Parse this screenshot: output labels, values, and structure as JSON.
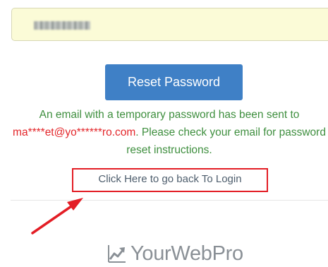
{
  "form": {
    "input_value": "",
    "reset_button_label": "Reset Password"
  },
  "message": {
    "prefix": "An email with a temporary password has been sent to ",
    "masked_email": "ma****et@yo******ro.com",
    "suffix": ". Please check your email for password reset instructions."
  },
  "login_link": {
    "label": "Click Here to go back To Login"
  },
  "logo": {
    "text": "YourWebPro"
  },
  "colors": {
    "button": "#3f80c6",
    "message": "#3f8f3f",
    "email": "#e3262a",
    "annotation": "#e31d25",
    "input_background": "#fbfbd7"
  },
  "icons": {
    "logo": "trending-up-chart-icon",
    "annotation": "red-arrow-icon"
  }
}
